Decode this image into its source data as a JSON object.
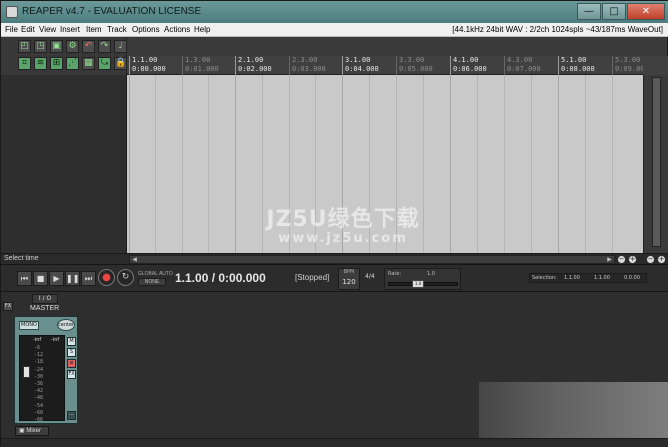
{
  "window": {
    "title": "REAPER v4.7 - EVALUATION LICENSE",
    "minimize": "—",
    "maximize": "□",
    "close": "✕"
  },
  "menu": {
    "items": [
      "File",
      "Edit",
      "View",
      "Insert",
      "Item",
      "Track",
      "Options",
      "Actions",
      "Help"
    ],
    "status": "[44.1kHz 24bit WAV : 2/2ch 1024spls ~43/187ms WaveOut]"
  },
  "ruler": {
    "marks": [
      {
        "bar": "1.1.00",
        "time": "0:00.000",
        "major": true
      },
      {
        "bar": "1.3.00",
        "time": "0:01.000",
        "major": false
      },
      {
        "bar": "2.1.00",
        "time": "0:02.000",
        "major": true
      },
      {
        "bar": "2.3.00",
        "time": "0:03.000",
        "major": false
      },
      {
        "bar": "3.1.00",
        "time": "0:04.000",
        "major": true
      },
      {
        "bar": "3.3.00",
        "time": "0:05.000",
        "major": false
      },
      {
        "bar": "4.1.00",
        "time": "0:06.000",
        "major": true
      },
      {
        "bar": "4.3.00",
        "time": "0:07.000",
        "major": false
      },
      {
        "bar": "5.1.00",
        "time": "0:08.000",
        "major": true
      },
      {
        "bar": "5.3.00",
        "time": "0:09.000",
        "major": false
      }
    ]
  },
  "watermark": {
    "line1": "JZ5U绿色下载",
    "line2": "www.jz5u.com"
  },
  "status_left": "Select time",
  "transport": {
    "global_auto_label": "GLOBAL AUTO",
    "global_auto_value": "NONE",
    "position": "1.1.00 / 0:00.000",
    "state": "[Stopped]",
    "bpm_label": "BPM",
    "bpm_value": "120",
    "time_sig": "4/4",
    "rate_label": "Rate:",
    "rate_value": "1.0",
    "rate_knob": "1.0",
    "rate_fraction": 0.4,
    "selection_label": "Selection:",
    "selection_start": "1.1.00",
    "selection_end": "1.1.00",
    "selection_length": "0.0.00"
  },
  "master": {
    "io": "I / O",
    "fx": "FX",
    "name": "MASTER",
    "mono": "MONO",
    "pan": "center",
    "meter_left": "-inf",
    "meter_right": "-inf",
    "scale": [
      "-6",
      "-12",
      "-18",
      "-24",
      "-30",
      "-36",
      "-42",
      "-48",
      "-54",
      "-60",
      "-66"
    ],
    "side_buttons": [
      "M",
      "S",
      "",
      "FX"
    ]
  },
  "mixer_tab": "Mixer",
  "colors": {
    "titlebar": "#5a8a8b",
    "arrange_bg": "#c9c9c9",
    "master_strip": "#6a8f8f",
    "record": "#e44444"
  }
}
